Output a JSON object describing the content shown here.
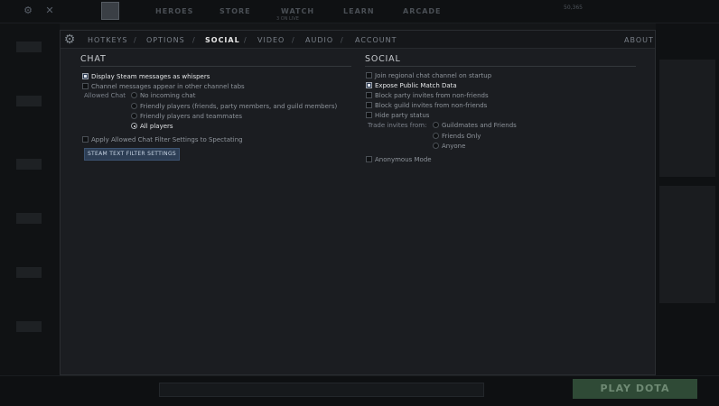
{
  "topbar": {
    "nav": [
      "HEROES",
      "STORE",
      "WATCH",
      "LEARN",
      "ARCADE"
    ],
    "sublabel": "3 ON LIVE",
    "coins": "50,365"
  },
  "settings": {
    "tabs": [
      "HOTKEYS",
      "OPTIONS",
      "SOCIAL",
      "VIDEO",
      "AUDIO",
      "ACCOUNT"
    ],
    "active_tab": "SOCIAL",
    "about": "ABOUT",
    "chat": {
      "title": "CHAT",
      "display_whispers": "Display Steam messages as whispers",
      "channel_tabs": "Channel messages appear in other channel tabs",
      "allowed_chat_label": "Allowed Chat",
      "options": [
        "No incoming chat",
        "Friendly players (friends, party members, and guild members)",
        "Friendly players and teammates",
        "All players"
      ],
      "apply_filter": "Apply Allowed Chat Filter Settings to Spectating",
      "filter_button": "STEAM TEXT FILTER SETTINGS"
    },
    "social": {
      "title": "SOCIAL",
      "join_regional": "Join regional chat channel on startup",
      "expose_match": "Expose Public Match Data",
      "block_party": "Block party invites from non-friends",
      "block_guild": "Block guild invites from non-friends",
      "hide_party": "Hide party status",
      "trade_label": "Trade invites from:",
      "trade_options": [
        "Guildmates and Friends",
        "Friends Only",
        "Anyone"
      ],
      "anonymous": "Anonymous Mode"
    }
  },
  "bottombar": {
    "play": "PLAY DOTA"
  }
}
